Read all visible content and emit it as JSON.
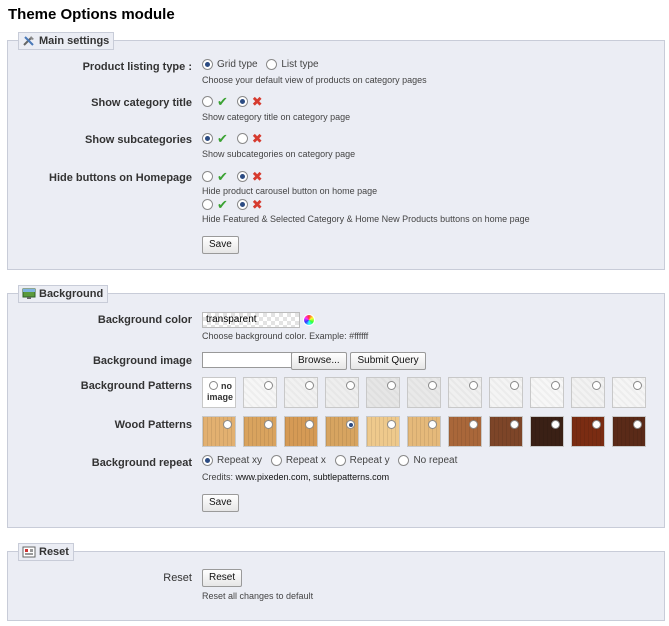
{
  "page_title": "Theme Options module",
  "main_settings": {
    "legend": "Main settings",
    "legend_icon": "tools-icon",
    "listing": {
      "label": "Product listing type :",
      "opt_grid": "Grid type",
      "opt_list": "List type",
      "selected": "Grid type",
      "hint": "Choose your default view of products on category pages"
    },
    "category_title": {
      "label": "Show category title",
      "selected": "no",
      "hint": "Show category title on category page"
    },
    "subcategories": {
      "label": "Show subcategories",
      "selected": "yes",
      "hint": "Show subcategories on category page"
    },
    "hide_buttons": {
      "label": "Hide buttons on Homepage",
      "carousel_selected": "yes",
      "carousel_hint": "Hide product carousel button on home page",
      "featured_selected": "no",
      "featured_hint": "Hide Featured & Selected Category & Home New Products buttons on home page"
    },
    "save_label": "Save"
  },
  "background": {
    "legend": "Background",
    "legend_icon": "monitor-icon",
    "color": {
      "label": "Background color",
      "value": "transparent",
      "hint": "Choose background color. Example: #ffffff"
    },
    "image": {
      "label": "Background image",
      "browse_label": "Browse...",
      "submit_label": "Submit Query"
    },
    "patterns": {
      "label": "Background Patterns",
      "no_image_line1": "no",
      "no_image_line2": "image",
      "count": 11
    },
    "wood": {
      "label": "Wood Patterns",
      "colors": [
        "#e2b070",
        "#d9a35e",
        "#d59a55",
        "#d7a460",
        "#eec98c",
        "#e5b97a",
        "#a9673a",
        "#7d4528",
        "#3a2015",
        "#7a2c12",
        "#5a2a18"
      ],
      "selected_index": 3
    },
    "repeat": {
      "label": "Background repeat",
      "options": [
        "Repeat xy",
        "Repeat x",
        "Repeat y",
        "No repeat"
      ],
      "selected": "Repeat xy",
      "credits_prefix": "Credits:",
      "credits_sites": "www.pixeden.com, subtlepatterns.com"
    },
    "save_label": "Save"
  },
  "reset": {
    "legend": "Reset",
    "legend_icon": "reset-icon",
    "label": "Reset",
    "button_label": "Reset",
    "hint": "Reset all changes to default"
  }
}
